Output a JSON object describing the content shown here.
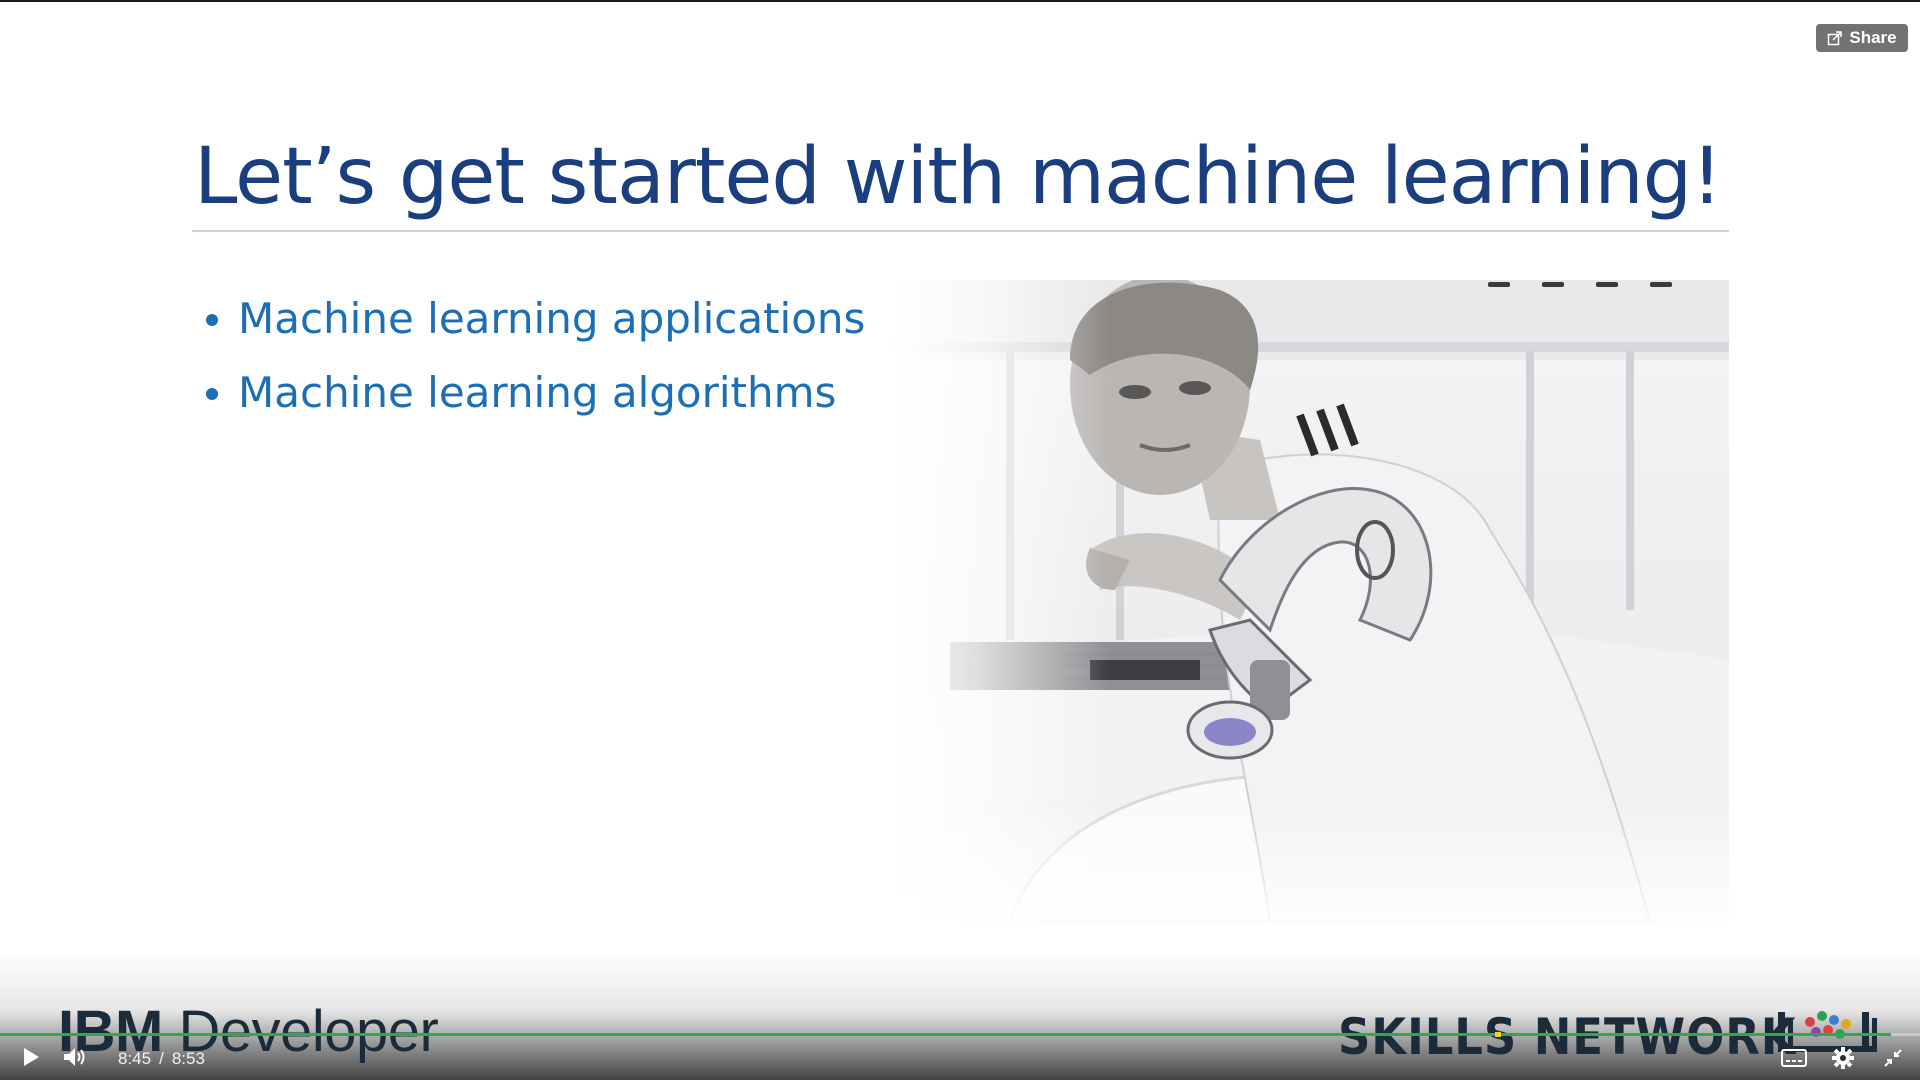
{
  "share": {
    "label": "Share",
    "icon": "share-icon"
  },
  "slide": {
    "title": "Let’s get started with machine learning!",
    "bullets": [
      "Machine learning applications",
      "Machine learning algorithms"
    ],
    "image": "man-with-robotic-arm-photo"
  },
  "branding": {
    "left_strong": "IBM",
    "left_light": " Developer",
    "right": "SKILLS NETWORK",
    "right_logo": "skills-network-logo"
  },
  "player": {
    "current_time": "8:45",
    "separator": "/",
    "duration": "8:53",
    "progress": 0.985,
    "progress_color": "#2fa84f",
    "controls": [
      "play-icon",
      "volume-icon",
      "captions-icon",
      "settings-icon",
      "exit-fullscreen-icon"
    ]
  },
  "colors": {
    "title": "#1b3f7e",
    "bullets": "#1d6fb5"
  }
}
